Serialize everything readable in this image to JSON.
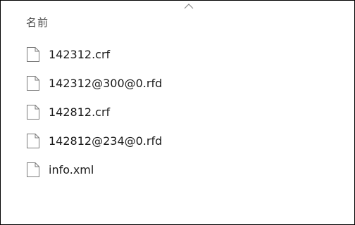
{
  "header": {
    "name_column": "名前"
  },
  "files": [
    {
      "name": "142312.crf",
      "icon": "generic-file-icon"
    },
    {
      "name": "142312@300@0.rfd",
      "icon": "generic-file-icon"
    },
    {
      "name": "142812.crf",
      "icon": "generic-file-icon"
    },
    {
      "name": "142812@234@0.rfd",
      "icon": "generic-file-icon"
    },
    {
      "name": "info.xml",
      "icon": "generic-file-icon"
    }
  ]
}
